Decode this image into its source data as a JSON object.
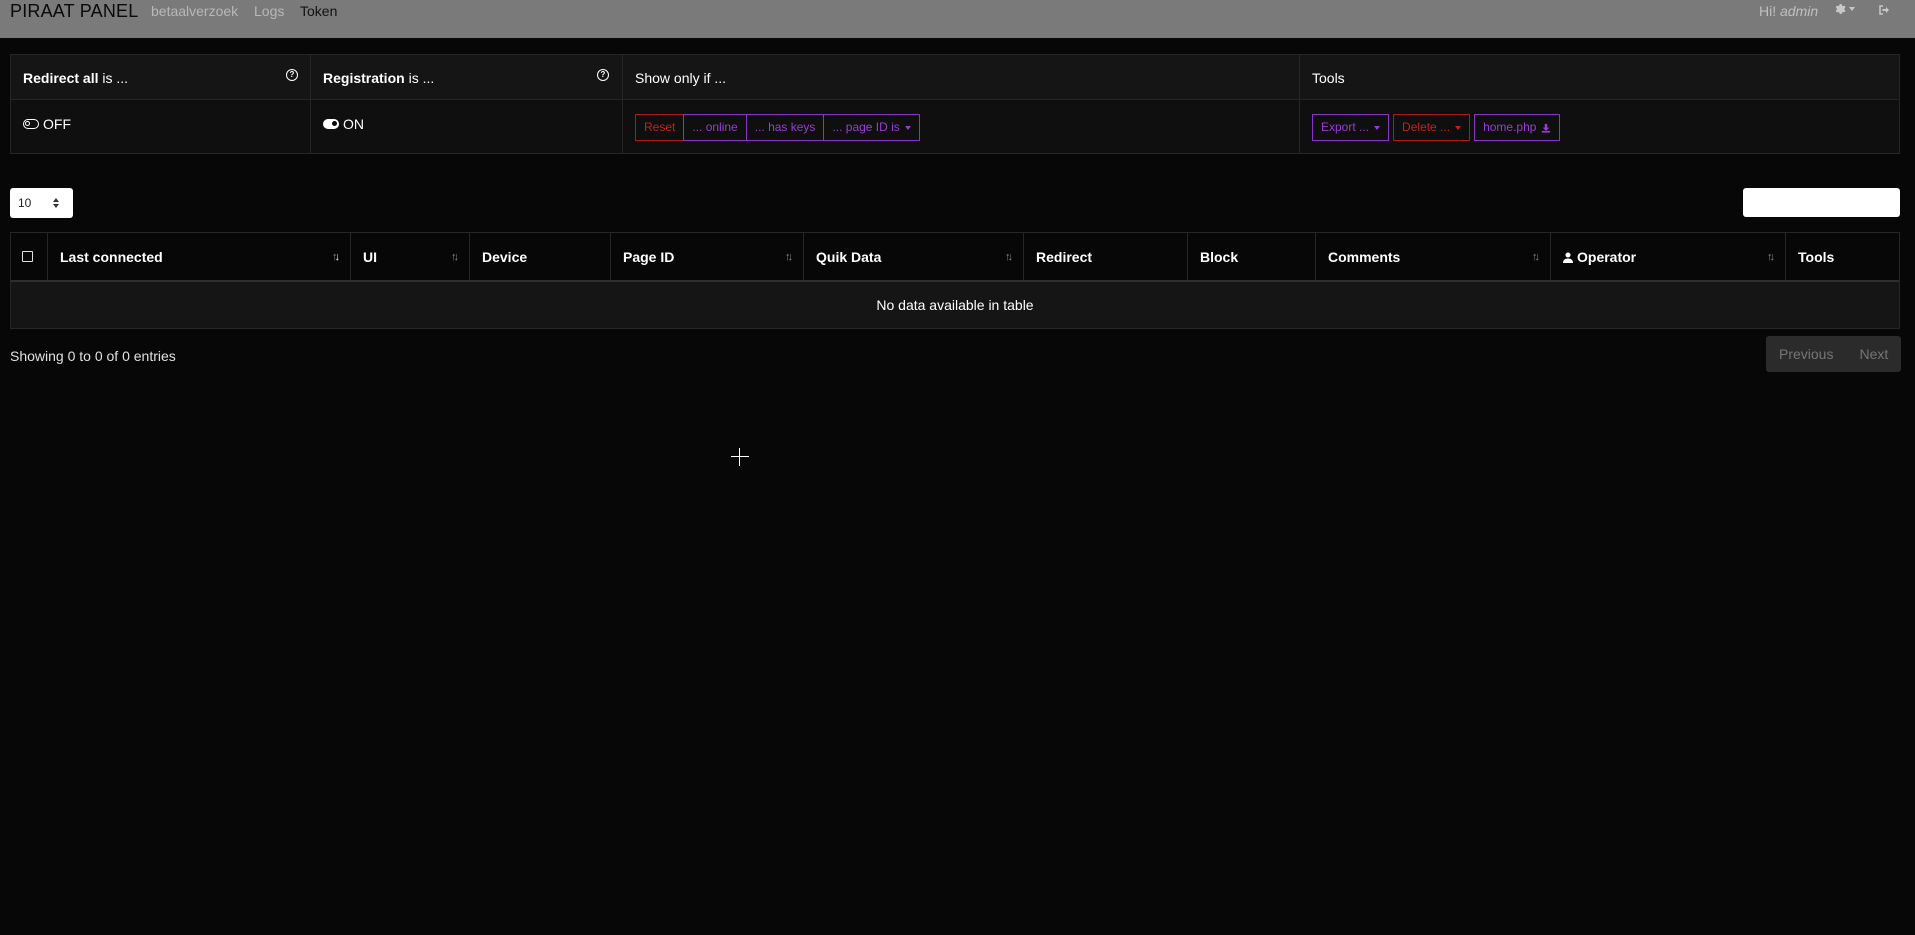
{
  "navbar": {
    "brand": "PIRAAT PANEL",
    "links": [
      "betaalverzoek",
      "Logs",
      "Token"
    ],
    "active_link": "Token",
    "greeting": "Hi!",
    "user": "admin",
    "icons": [
      "gear-icon",
      "logout-icon"
    ]
  },
  "panel": {
    "redirect": {
      "title_bold": "Redirect all",
      "title_rest": " is ...",
      "state": "OFF"
    },
    "registration": {
      "title_bold": "Registration",
      "title_rest": " is ...",
      "state": "ON"
    },
    "filters": {
      "title": "Show only if ...",
      "buttons": [
        "Reset",
        "... online",
        "... has keys",
        "... page ID is"
      ]
    },
    "tools": {
      "title": "Tools",
      "export_label": "Export ...",
      "delete_label": "Delete ...",
      "home_label": "home.php"
    }
  },
  "table_controls": {
    "page_length": "10",
    "search_value": ""
  },
  "table": {
    "columns": [
      "Last connected",
      "UI",
      "Device",
      "Page ID",
      "Quik Data",
      "Redirect",
      "Block",
      "Comments",
      "Operator",
      "Tools"
    ],
    "empty_message": "No data available in table"
  },
  "footer": {
    "info": "Showing 0 to 0 of 0 entries",
    "previous": "Previous",
    "next": "Next"
  },
  "colors": {
    "background": "#070707",
    "navbar": "#7a7a7a",
    "danger": "#cc1c1c",
    "accent": "#9a3bd6"
  }
}
